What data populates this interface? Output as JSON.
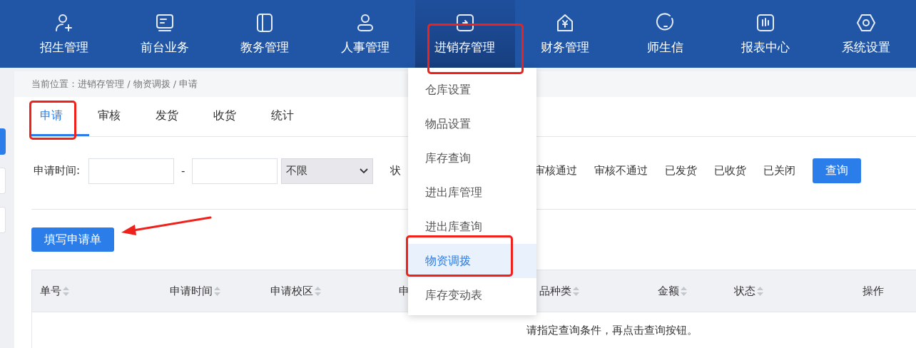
{
  "nav": [
    {
      "label": "招生管理",
      "selected": false
    },
    {
      "label": "前台业务",
      "selected": false
    },
    {
      "label": "教务管理",
      "selected": false
    },
    {
      "label": "人事管理",
      "selected": false
    },
    {
      "label": "进销存管理",
      "selected": true
    },
    {
      "label": "财务管理",
      "selected": false
    },
    {
      "label": "师生信",
      "selected": false
    },
    {
      "label": "报表中心",
      "selected": false
    },
    {
      "label": "系统设置",
      "selected": false
    }
  ],
  "menu": [
    {
      "label": "仓库设置",
      "selected": false
    },
    {
      "label": "物品设置",
      "selected": false
    },
    {
      "label": "库存查询",
      "selected": false
    },
    {
      "label": "进出库管理",
      "selected": false
    },
    {
      "label": "进出库查询",
      "selected": false
    },
    {
      "label": "物资调拨",
      "selected": true
    },
    {
      "label": "库存变动表",
      "selected": false
    }
  ],
  "sidebar": [
    {
      "selected": true
    },
    {
      "selected": false
    },
    {
      "selected": false
    }
  ],
  "breadcrumb": "当前位置：进销存管理 / 物资调拨 / 申请",
  "tabs": [
    {
      "label": "申请",
      "selected": true
    },
    {
      "label": "审核",
      "selected": false
    },
    {
      "label": "发货",
      "selected": false
    },
    {
      "label": "收货",
      "selected": false
    },
    {
      "label": "统计",
      "selected": false
    }
  ],
  "filter": {
    "label": "申请时间:",
    "separator": "-",
    "range_select": "不限",
    "status_label": "状",
    "status_options": [
      "审核通过",
      "审核不通过",
      "已发货",
      "已收货",
      "已关闭"
    ],
    "search_button": "查询"
  },
  "new_button": "填写申请单",
  "table": {
    "columns": [
      {
        "label": "单号",
        "sortable": true
      },
      {
        "label": "申请时间",
        "sortable": true
      },
      {
        "label": "申请校区",
        "sortable": true
      },
      {
        "label": "申"
      },
      {
        "label": "品种类",
        "sortable": true
      },
      {
        "label": "金额",
        "sortable": true
      },
      {
        "label": "状态",
        "sortable": true
      },
      {
        "label": "操作",
        "sortable": false
      }
    ],
    "empty_message": "请指定查询条件，再点击查询按钮。"
  }
}
